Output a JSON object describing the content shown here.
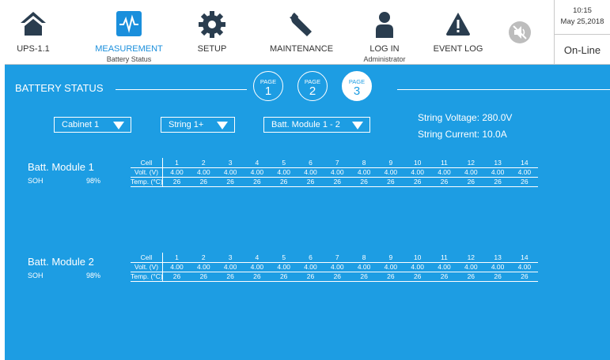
{
  "nav": {
    "ups": {
      "label": "UPS-1.1",
      "icon": "home-icon"
    },
    "measurement": {
      "label": "MEASUREMENT",
      "sub": "Battery Status",
      "icon": "pulse-icon"
    },
    "setup": {
      "label": "SETUP",
      "icon": "gear-icon"
    },
    "maintenance": {
      "label": "MAINTENANCE",
      "icon": "wrench-icon"
    },
    "login": {
      "label": "LOG IN",
      "sub": "Administrator",
      "icon": "user-icon"
    },
    "eventlog": {
      "label": "EVENT LOG",
      "icon": "warning-icon"
    },
    "mute": {
      "icon": "speaker-mute-icon"
    }
  },
  "clock": {
    "time": "10:15",
    "date": "May 25,2018"
  },
  "status": "On-Line",
  "colors": {
    "panel": "#1d9de3",
    "accent": "#1a8fdc"
  },
  "section_title": "BATTERY STATUS",
  "pages": [
    {
      "word": "PAGE",
      "num": "1"
    },
    {
      "word": "PAGE",
      "num": "2"
    },
    {
      "word": "PAGE",
      "num": "3",
      "active": true
    }
  ],
  "dropdowns": {
    "cabinet": "Cabinet 1",
    "string": "String 1+",
    "module": "Batt. Module 1 - 2"
  },
  "string_voltage": "String Voltage:  280.0V",
  "string_current": "String Current:   10.0A",
  "row_labels": {
    "cell": "Cell",
    "volt": "Volt. (V)",
    "temp": "Temp. (°C)"
  },
  "modules": [
    {
      "name": "Batt. Module  1",
      "soh_label": "SOH",
      "soh_value": "98%",
      "cells": [
        "1",
        "2",
        "3",
        "4",
        "5",
        "6",
        "7",
        "8",
        "9",
        "10",
        "11",
        "12",
        "13",
        "14"
      ],
      "volts": [
        "4.00",
        "4.00",
        "4.00",
        "4.00",
        "4.00",
        "4.00",
        "4.00",
        "4.00",
        "4.00",
        "4.00",
        "4.00",
        "4.00",
        "4.00",
        "4.00"
      ],
      "temps": [
        "26",
        "26",
        "26",
        "26",
        "26",
        "26",
        "26",
        "26",
        "26",
        "26",
        "26",
        "26",
        "26",
        "26"
      ]
    },
    {
      "name": "Batt. Module  2",
      "soh_label": "SOH",
      "soh_value": "98%",
      "cells": [
        "1",
        "2",
        "3",
        "4",
        "5",
        "6",
        "7",
        "8",
        "9",
        "10",
        "11",
        "12",
        "13",
        "14"
      ],
      "volts": [
        "4.00",
        "4.00",
        "4.00",
        "4.00",
        "4.00",
        "4.00",
        "4.00",
        "4.00",
        "4.00",
        "4.00",
        "4.00",
        "4.00",
        "4.00",
        "4.00"
      ],
      "temps": [
        "26",
        "26",
        "26",
        "26",
        "26",
        "26",
        "26",
        "26",
        "26",
        "26",
        "26",
        "26",
        "26",
        "26"
      ]
    }
  ]
}
